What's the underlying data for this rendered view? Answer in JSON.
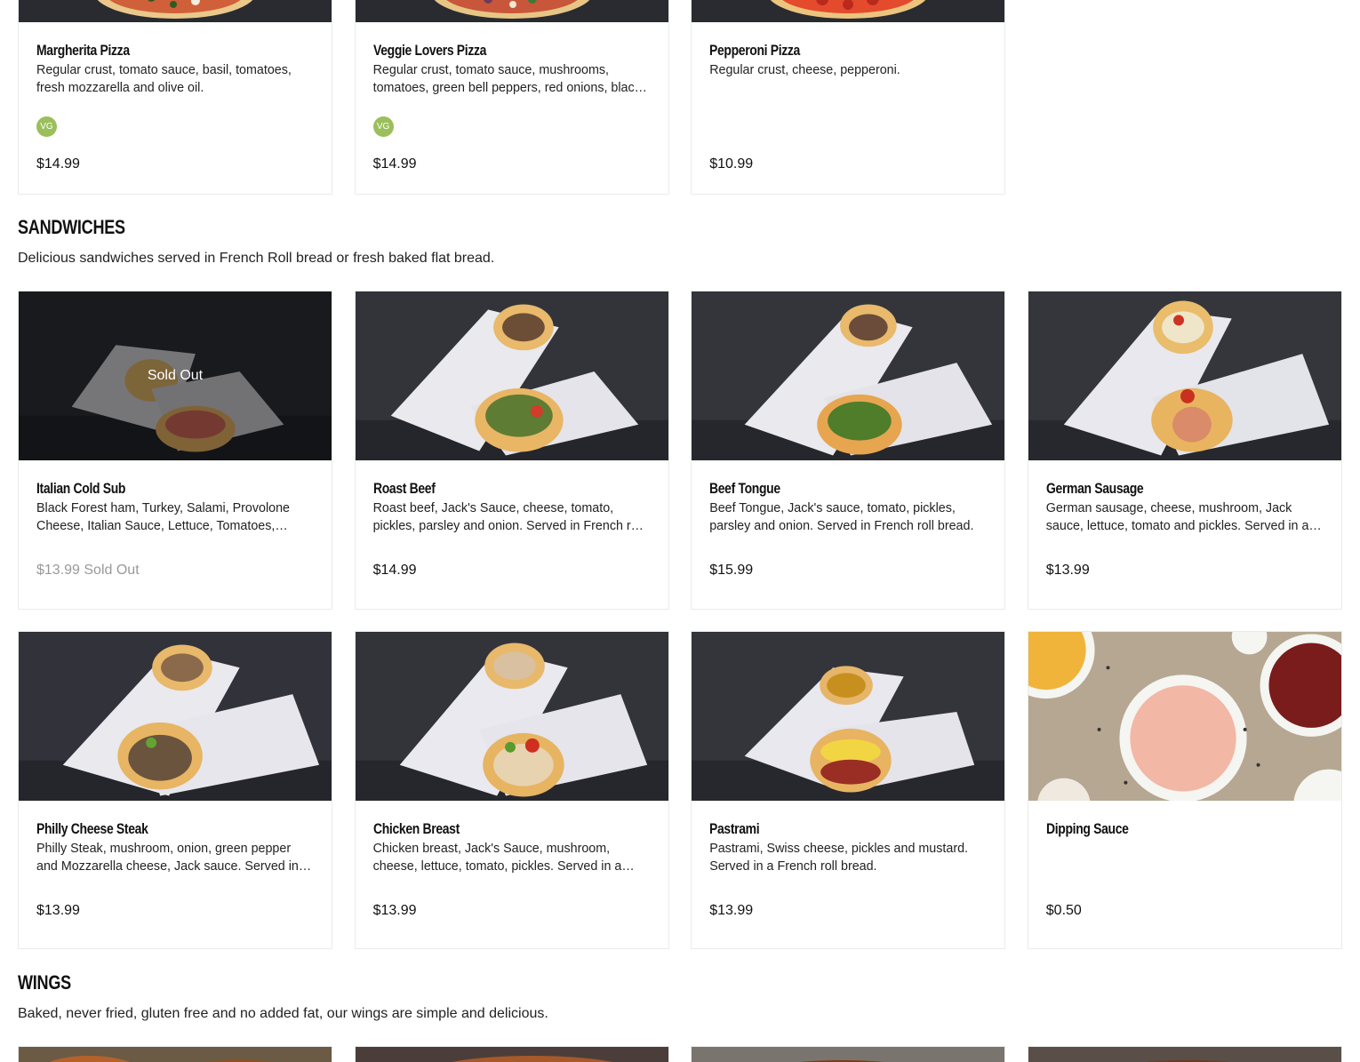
{
  "pizzas": [
    {
      "name": "Margherita Pizza",
      "desc": "Regular crust, tomato sauce, basil, tomatoes, fresh mozzarella and olive oil.",
      "badge": "VG",
      "price": "$14.99"
    },
    {
      "name": "Veggie Lovers Pizza",
      "desc": "Regular crust, tomato sauce, mushrooms, tomatoes, green bell peppers, red onions, black olives.",
      "badge": "VG",
      "price": "$14.99"
    },
    {
      "name": "Pepperoni Pizza",
      "desc": "Regular crust, cheese, pepperoni.",
      "price": "$10.99"
    }
  ],
  "sandwiches": {
    "title": "SANDWICHES",
    "desc": "Delicious sandwiches served in French Roll bread or fresh baked flat bread.",
    "items": [
      {
        "name": "Italian Cold Sub",
        "desc": "Black Forest ham, Turkey, Salami, Provolone Cheese, Italian Sauce, Lettuce, Tomatoes, Pickles.",
        "price": "$13.99 Sold Out",
        "overlay": "Sold Out"
      },
      {
        "name": "Roast Beef",
        "desc": "Roast beef, Jack's Sauce, cheese, tomato, pickles, parsley and onion. Served in French roll bread.",
        "price": "$14.99"
      },
      {
        "name": "Beef Tongue",
        "desc": "Beef Tongue, Jack's sauce, tomato, pickles, parsley and onion. Served in French roll bread.",
        "price": "$15.99"
      },
      {
        "name": "German Sausage",
        "desc": "German sausage, cheese, mushroom, Jack sauce, lettuce, tomato and pickles. Served in a French roll bread.",
        "price": "$13.99"
      },
      {
        "name": "Philly Cheese Steak",
        "desc": "Philly Steak, mushroom, onion, green pepper and Mozzarella cheese, Jack sauce. Served in French roll bread.",
        "price": "$13.99"
      },
      {
        "name": "Chicken Breast",
        "desc": "Chicken breast, Jack's Sauce, mushroom, cheese, lettuce, tomato, pickles. Served in a French roll bread.",
        "price": "$13.99"
      },
      {
        "name": "Pastrami",
        "desc": "Pastrami, Swiss cheese, pickles and mustard. Served in a French roll bread.",
        "price": "$13.99"
      },
      {
        "name": "Dipping Sauce",
        "desc": "",
        "price": "$0.50"
      }
    ]
  },
  "wings": {
    "title": "WINGS",
    "desc": "Baked, never fried, gluten free and no added fat, our wings are simple and delicious."
  }
}
